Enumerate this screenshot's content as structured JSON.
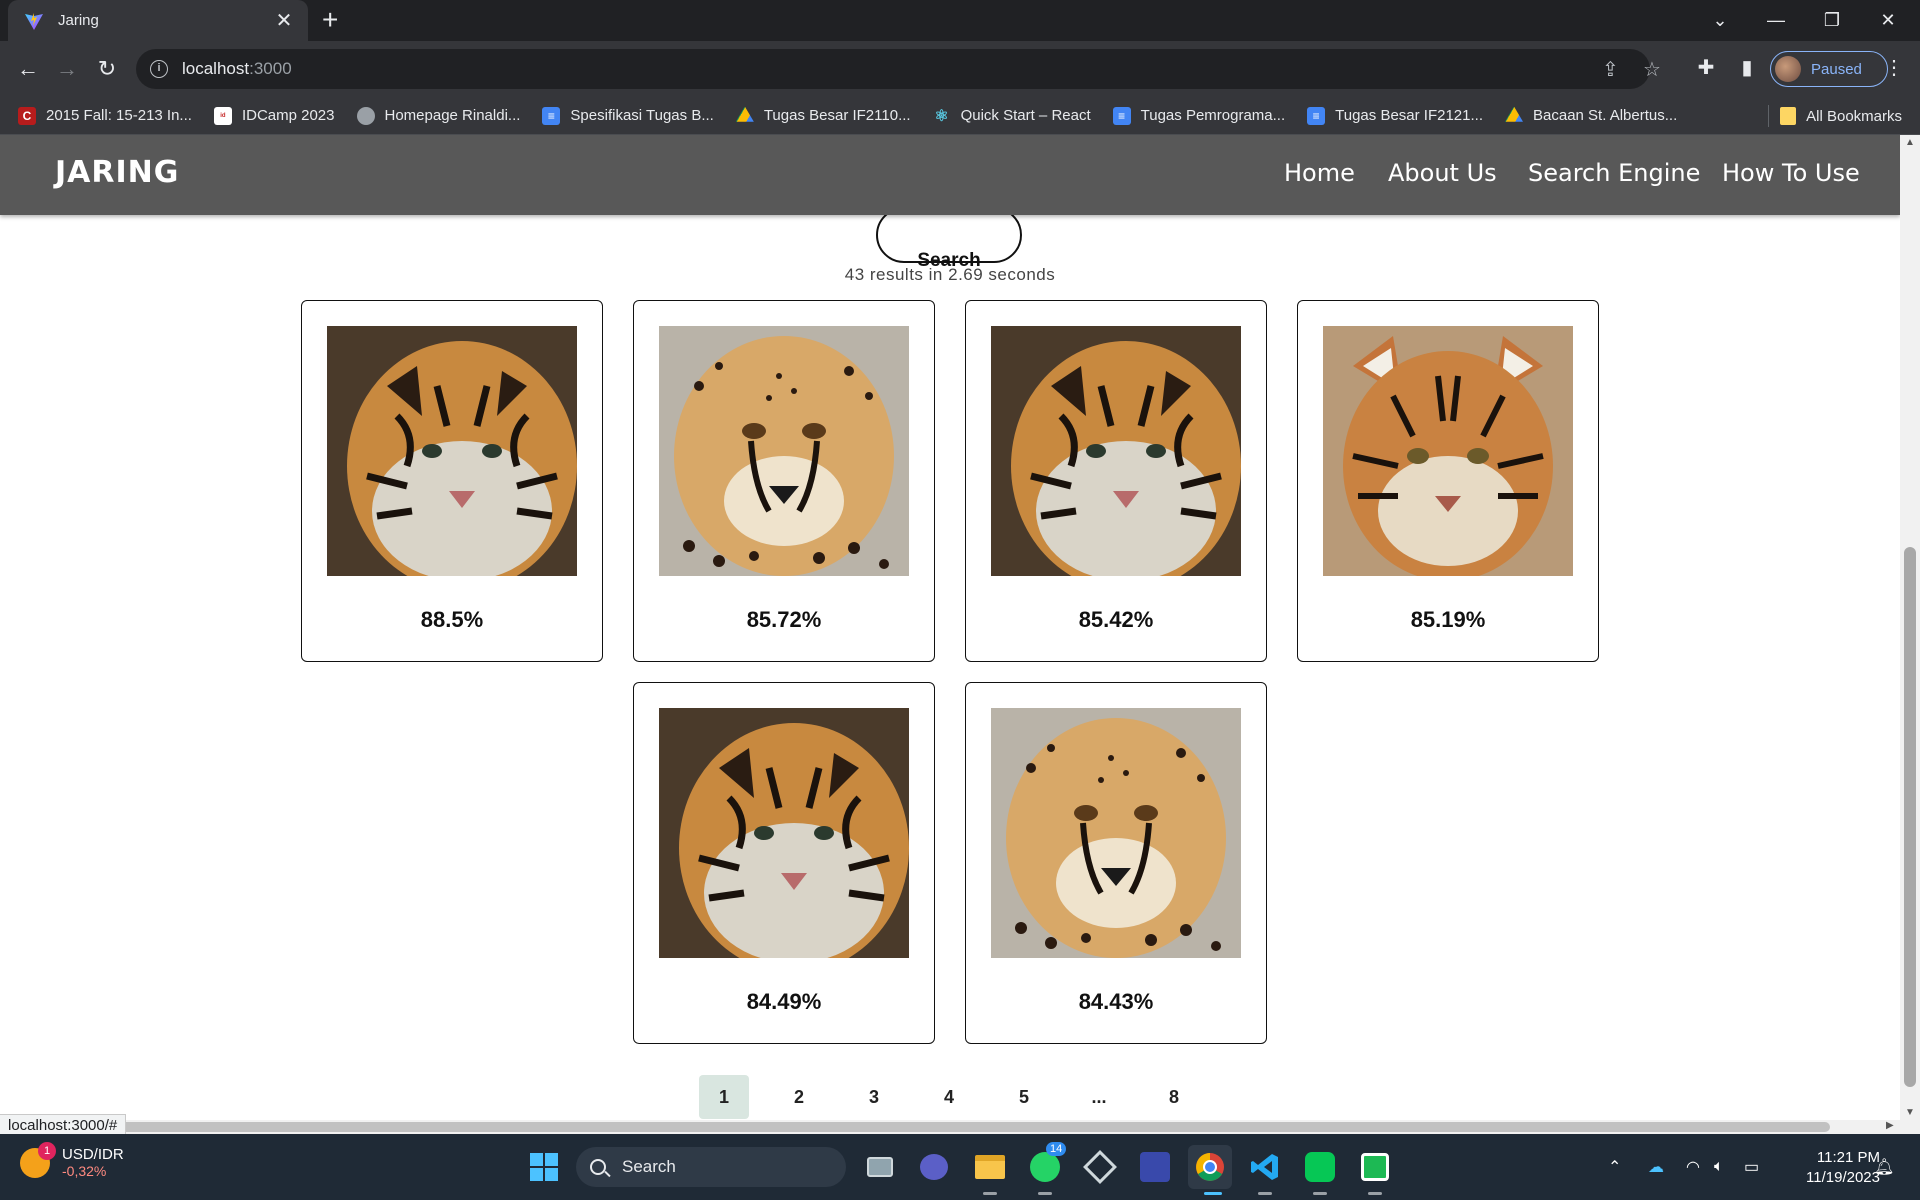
{
  "browser": {
    "tab_title": "Jaring",
    "url_host": "localhost",
    "url_port": ":3000",
    "profile_status": "Paused",
    "status_url": "localhost:3000/#",
    "bookmarks": [
      {
        "label": "2015 Fall: 15-213 In...",
        "icon": "cmu-icon",
        "color": "#b71c1c"
      },
      {
        "label": "IDCamp 2023",
        "icon": "idcamp-icon",
        "color": "#ffffff"
      },
      {
        "label": "Homepage Rinaldi...",
        "icon": "globe-icon",
        "color": "#9aa0a6"
      },
      {
        "label": "Spesifikasi Tugas B...",
        "icon": "docs-icon",
        "color": "#4285f4"
      },
      {
        "label": "Tugas Besar IF2110...",
        "icon": "drive-icon",
        "color": "#fbbc04"
      },
      {
        "label": "Quick Start – React",
        "icon": "react-icon",
        "color": "#58c4dc"
      },
      {
        "label": "Tugas Pemrograma...",
        "icon": "docs-icon",
        "color": "#4285f4"
      },
      {
        "label": "Tugas Besar IF2121...",
        "icon": "docs-icon",
        "color": "#4285f4"
      },
      {
        "label": "Bacaan St. Albertus...",
        "icon": "drive-icon",
        "color": "#fbbc04"
      }
    ],
    "all_bookmarks": "All Bookmarks"
  },
  "site": {
    "brand": "JARING",
    "nav": [
      "Home",
      "About Us",
      "Search Engine",
      "How To Use"
    ],
    "search_label": "Search",
    "results_info": "43 results in 2.69 seconds",
    "results": [
      {
        "score": "88.5%",
        "image": "tiger-photo"
      },
      {
        "score": "85.72%",
        "image": "cheetah-photo"
      },
      {
        "score": "85.42%",
        "image": "tiger-photo"
      },
      {
        "score": "85.19%",
        "image": "tiger-cub-photo"
      },
      {
        "score": "84.49%",
        "image": "tiger-photo"
      },
      {
        "score": "84.43%",
        "image": "cheetah-photo"
      }
    ],
    "pages": [
      "1",
      "2",
      "3",
      "4",
      "5",
      "...",
      "8"
    ],
    "active_page": "1"
  },
  "taskbar": {
    "ticker_name": "USD/IDR",
    "ticker_value": "-0,32%",
    "ticker_badge": "1",
    "search_label": "Search",
    "whatsapp_badge": "14",
    "time": "11:21 PM",
    "date": "11/19/2023"
  },
  "colors": {
    "site_nav_bg": "#585858",
    "active_page_bg": "#d9e6e0",
    "chrome_dark": "#202124",
    "chrome_toolbar": "#35363a"
  }
}
